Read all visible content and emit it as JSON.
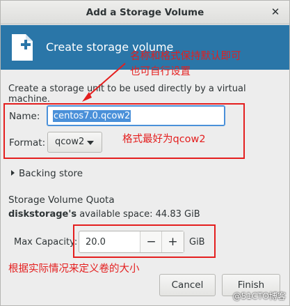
{
  "window": {
    "title": "Add a Storage Volume"
  },
  "banner": {
    "heading": "Create storage volume"
  },
  "description": "Create a storage unit to be used directly by a virtual machine.",
  "form": {
    "name_label": "Name:",
    "name_value": "centos7.0.qcow2",
    "format_label": "Format:",
    "format_value": "qcow2"
  },
  "backing_store": {
    "label": "Backing store"
  },
  "quota": {
    "title": "Storage Volume Quota",
    "pool_name": "diskstorage's",
    "available_text": "available space: 44.83 GiB",
    "max_capacity_label": "Max Capacity:",
    "max_capacity_value": "20.0",
    "minus": "−",
    "plus": "+",
    "unit": "GiB"
  },
  "buttons": {
    "cancel": "Cancel",
    "finish": "Finish"
  },
  "annotations": {
    "note_name_line1": "名称和格式保持默认即可",
    "note_name_line2": "也可自行设置",
    "note_format": "格式最好为qcow2",
    "note_capacity": "根据实际情况来定义卷的大小",
    "color": "#e41e1e"
  },
  "watermark": "@51CTO博客",
  "colors": {
    "banner": "#2a76a8",
    "selection": "#4a90d9"
  }
}
